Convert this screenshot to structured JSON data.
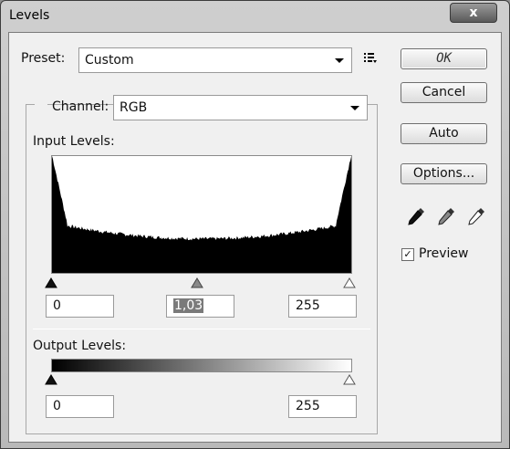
{
  "window": {
    "title": "Levels",
    "close_glyph": "x"
  },
  "preset": {
    "label": "Preset:",
    "value": "Custom"
  },
  "channel": {
    "label": "Channel:",
    "value": "RGB"
  },
  "input_levels": {
    "label": "Input Levels:",
    "black": "0",
    "gamma": "1,03",
    "white": "255"
  },
  "output_levels": {
    "label": "Output Levels:",
    "black": "0",
    "white": "255"
  },
  "buttons": {
    "ok": "OK",
    "cancel": "Cancel",
    "auto": "Auto",
    "options": "Options..."
  },
  "preview": {
    "label": "Preview",
    "checked": true,
    "check_glyph": "✓"
  },
  "icons": [
    "close-icon",
    "preset-menu-icon",
    "dropdown-arrow-icon",
    "black-eyedropper-icon",
    "gray-eyedropper-icon",
    "white-eyedropper-icon",
    "slider-triangle-icon"
  ]
}
